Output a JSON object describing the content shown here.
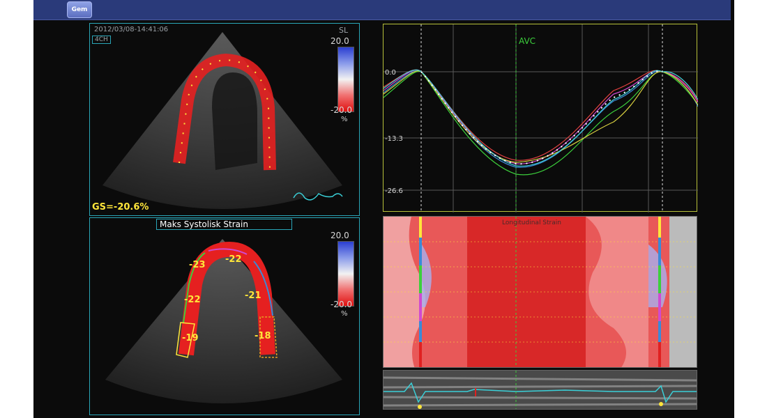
{
  "toolbar": {
    "gem_label": "Gem"
  },
  "echo_top": {
    "timestamp": "2012/03/08-14:41:06",
    "view": "4CH",
    "scale_name": "SL",
    "scale_max": "20.0",
    "scale_min": "-20.0",
    "unit": "%",
    "global_strain": "GS=-20.6%"
  },
  "echo_bottom": {
    "title": "Maks Systolisk Strain",
    "scale_max": "20.0",
    "scale_min": "-20.0",
    "unit": "%",
    "segments": [
      "-23",
      "-22",
      "-22",
      "-21",
      "-19",
      "-18"
    ]
  },
  "graph": {
    "event_label": "AVC",
    "y_labels": [
      "0.0",
      "-13.3",
      "-26.6"
    ]
  },
  "mmode": {
    "title": "Longitudinal Strain"
  },
  "colors": {
    "panel_border": "#2aa6b8",
    "graph_border": "#b8c23a",
    "label_yellow": "#ffe63a",
    "avc_green": "#3ccf3c"
  }
}
